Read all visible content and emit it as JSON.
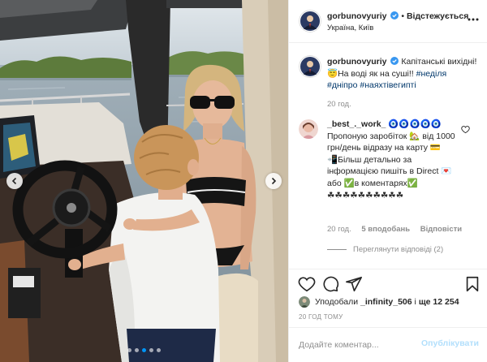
{
  "header": {
    "username": "gorbunovyuriy",
    "separator": "•",
    "follow_status": "Відстежується",
    "location": "Україна, Київ"
  },
  "caption": {
    "username": "gorbunovyuriy",
    "text": "Капітанські вихідні! 😇На воді як на суші!!",
    "hashtags": [
      "#неділя",
      "#дніпро",
      "#наяхтівегипті"
    ],
    "time": "20 год."
  },
  "comment": {
    "username": "_best_._work_",
    "paragraphs": [
      "🧿🧿🧿🧿🧿",
      "Пропоную заробіток 🏡 від 1000 грн/день відразу на карту 💳",
      "📲Більш детально за інформацією пишіть в Direct 💌 або ✅в коментарях✅",
      "☘☘☘☘☘☘☘☘☘☘"
    ],
    "time": "20 год.",
    "likes": "5 вподобань",
    "reply_label": "Відповісти",
    "view_replies": "Переглянути відповіді (2)"
  },
  "likes": {
    "prefix": "Уподобали",
    "user": "_infinity_506",
    "conj": "і",
    "rest": "ще 12 254"
  },
  "post_time": "20 ГОД ТОМУ",
  "comment_box": {
    "placeholder": "Додайте коментар...",
    "submit_label": "Опублікувати"
  },
  "carousel": {
    "slide_count": 5,
    "active_index": 2
  },
  "icons": {
    "verified": "verified-badge-icon",
    "more": "more-dots-icon",
    "like": "heart-icon",
    "comment": "comment-bubble-icon",
    "share": "paper-plane-icon",
    "save": "bookmark-icon",
    "prev": "chevron-left-icon",
    "next": "chevron-right-icon"
  },
  "colors": {
    "accent": "#0095f6",
    "verified": "#3897f0",
    "hashtag": "#00376b",
    "muted": "#8e8e8e",
    "text": "#262626",
    "submit_disabled": "#b2dffc"
  }
}
